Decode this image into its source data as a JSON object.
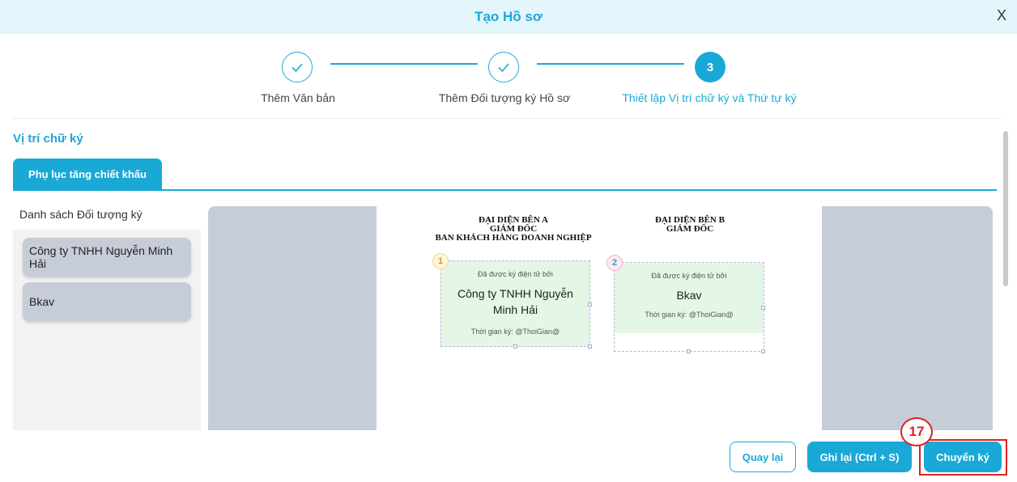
{
  "dialog": {
    "title": "Tạo Hồ sơ",
    "close_label": "X"
  },
  "stepper": {
    "steps": [
      {
        "label": "Thêm Văn bản",
        "state": "done"
      },
      {
        "label": "Thêm Đối tượng ký Hồ sơ",
        "state": "done"
      },
      {
        "label": "Thiết lập Vị trí chữ ký và Thứ tự ký",
        "number": "3",
        "state": "active"
      }
    ]
  },
  "section": {
    "title": "Vị trí chữ ký"
  },
  "tabs": [
    {
      "label": "Phụ lục tăng chiết khấu",
      "active": true
    }
  ],
  "signers": {
    "title": "Danh sách Đối tượng ký",
    "items": [
      {
        "label": "Công ty TNHH Nguyễn Minh Hải"
      },
      {
        "label": "Bkav"
      }
    ]
  },
  "document": {
    "party_a": {
      "line1": "ĐẠI DIỆN BÊN A",
      "line2": "GIÁM ĐỐC",
      "line3": "BAN KHÁCH HÀNG DOANH NGHIỆP"
    },
    "party_b": {
      "line1": "ĐẠI DIỆN BÊN B",
      "line2": "GIÁM ĐỐC"
    },
    "signature_boxes": [
      {
        "order": "1",
        "signed_by_text": "Đã được ký điện tử bởi",
        "name": "Công ty TNHH Nguyễn Minh Hải",
        "time_text": "Thời gian ký: @ThoiGian@"
      },
      {
        "order": "2",
        "signed_by_text": "Đã được ký điện tử bởi",
        "name": "Bkav",
        "time_text": "Thời gian ký: @ThoiGian@"
      }
    ]
  },
  "footer": {
    "back_label": "Quay lại",
    "save_label": "Ghi lại (Ctrl + S)",
    "send_label": "Chuyển ký",
    "step_marker": "17"
  },
  "colors": {
    "accent": "#1aa9d6",
    "header_bg": "#e2f6fc",
    "panel_gray": "#c7cdd8",
    "sig_green": "#e4f6e6",
    "highlight_red": "#e02020"
  }
}
